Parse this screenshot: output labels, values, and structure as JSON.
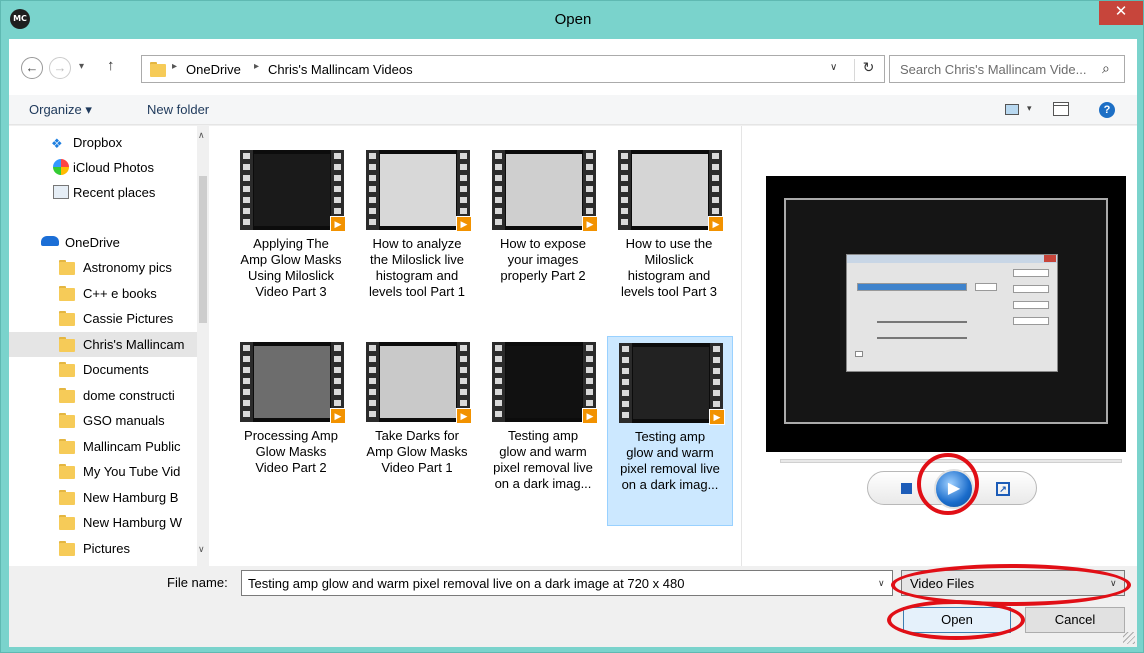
{
  "window": {
    "title": "Open",
    "app_icon": "MC",
    "close_glyph": "✕"
  },
  "nav": {
    "back": "←",
    "forward": "→",
    "recent_drop": "▾",
    "up": "↑",
    "breadcrumb": [
      "OneDrive",
      "Chris's Mallincam Videos"
    ],
    "breadcrumb_sep": "▸",
    "path_drop": "∨",
    "refresh": "↻",
    "search_placeholder": "Search Chris's Mallincam Vide...",
    "search_glyph": "⌕"
  },
  "toolbar": {
    "organize": "Organize ▾",
    "new_folder": "New folder",
    "view_drop": "▾",
    "help": "?"
  },
  "sidebar": {
    "scroll_up": "∧",
    "scroll_down": "∨",
    "top_items": [
      "Dropbox",
      "iCloud Photos",
      "Recent places"
    ],
    "dropbox_glyph": "❖",
    "onedrive": "OneDrive",
    "folders": [
      "Astronomy pics",
      "C++ e books",
      "Cassie Pictures",
      "Chris's Mallincam",
      "Documents",
      "dome constructi",
      "GSO manuals",
      "Mallincam Public",
      "My You Tube Vid",
      "New Hamburg B",
      "New Hamburg W",
      "Pictures"
    ],
    "selected": "Chris's Mallincam"
  },
  "files": [
    {
      "name": "Applying The Amp Glow Masks Using Miloslick Video Part 3",
      "lines": [
        "Applying The",
        "Amp Glow Masks",
        "Using Miloslick",
        "Video Part 3"
      ],
      "screen": "#1a1a1a",
      "selected": false
    },
    {
      "name": "How to analyze the Miloslick live histogram and levels tool Part 1",
      "lines": [
        "How to analyze",
        "the Miloslick live",
        "histogram and",
        "levels tool Part 1"
      ],
      "screen": "#d8d8d8",
      "selected": false
    },
    {
      "name": "How to expose your images properly Part 2",
      "lines": [
        "How to expose",
        "your images",
        "properly Part 2"
      ],
      "screen": "#cfcfcf",
      "selected": false
    },
    {
      "name": "How to use the Miloslick histogram and levels tool Part 3",
      "lines": [
        "How to use the",
        "Miloslick",
        "histogram and",
        "levels tool Part 3"
      ],
      "screen": "#d5d5d5",
      "selected": false
    },
    {
      "name": "Processing Amp Glow Masks Video Part 2",
      "lines": [
        "Processing Amp",
        "Glow Masks",
        "Video Part 2"
      ],
      "screen": "#6d6d6d",
      "selected": false
    },
    {
      "name": "Take Darks for Amp Glow Masks Video Part 1",
      "lines": [
        "Take Darks for",
        "Amp Glow Masks",
        "Video Part 1"
      ],
      "screen": "#c9c9c9",
      "selected": false
    },
    {
      "name": "Testing amp glow and warm pixel removal live on a dark imag...",
      "lines": [
        "Testing amp",
        "glow and warm",
        "pixel removal live",
        "on a dark imag..."
      ],
      "screen": "#111111",
      "selected": false
    },
    {
      "name": "Testing amp glow and warm pixel removal live on a dark imag...",
      "lines": [
        "Testing amp",
        "glow and warm",
        "pixel removal live",
        "on a dark imag..."
      ],
      "screen": "#222222",
      "selected": true
    }
  ],
  "play_badge": "▶",
  "preview": {
    "stop_icon": "stop-icon",
    "play_glyph": "▶",
    "popout_glyph": "↗"
  },
  "bottom": {
    "filename_label": "File name:",
    "filename_value": "Testing amp glow and warm pixel removal live on a dark image at 720 x 480",
    "filename_drop": "∨",
    "filetype": "Video Files",
    "filetype_drop": "∨",
    "open": "Open",
    "cancel": "Cancel"
  },
  "colors": {
    "titlebar": "#7ad3cc",
    "close": "#c7453b",
    "selection": "#cce8ff",
    "annotation": "#e10f16",
    "folder": "#f6cb58"
  }
}
